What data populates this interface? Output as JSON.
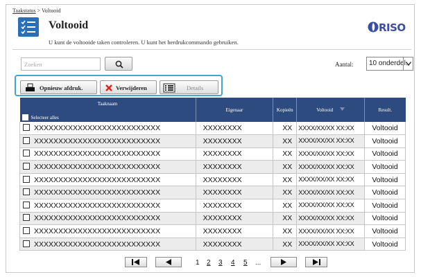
{
  "breadcrumb": {
    "parent": "Taakstatus",
    "separator": " > ",
    "current": "Voltooid"
  },
  "header": {
    "title": "Voltooid",
    "subtitle": "U kunt de voltooide taken controleren. U kunt het herdrukcommando gebruiken.",
    "icon": "completed-list-icon",
    "logo": "RISO"
  },
  "search": {
    "placeholder": "Zoeken",
    "value": "",
    "button_icon": "magnifier-icon"
  },
  "page_size": {
    "label": "Aantal:",
    "selected": "10 onderdel."
  },
  "toolbar": {
    "reprint_label": "Opnieuw afdruk.",
    "delete_label": "Verwijderen",
    "details_label": "Details",
    "accent": "#3fa6d4"
  },
  "table": {
    "header_color": "#2e4b80",
    "columns": [
      "Taaknaam",
      "Eigenaar",
      "Kopieën",
      "Voltooid",
      "Result."
    ],
    "select_all_label": "Selecteer alles",
    "rows": [
      {
        "name": "XXXXXXXXXXXXXXXXXXXXXXXXXX",
        "owner": "XXXXXXXX",
        "copies": "XX",
        "date": "XXXX/XX/XX XX:XX",
        "result": "Voltooid"
      },
      {
        "name": "XXXXXXXXXXXXXXXXXXXXXXXXXX",
        "owner": "XXXXXXXX",
        "copies": "XX",
        "date": "XXXX/XX/XX XX:XX",
        "result": "Voltooid"
      },
      {
        "name": "XXXXXXXXXXXXXXXXXXXXXXXXXX",
        "owner": "XXXXXXXX",
        "copies": "XX",
        "date": "XXXX/XX/XX XX:XX",
        "result": "Voltooid"
      },
      {
        "name": "XXXXXXXXXXXXXXXXXXXXXXXXXX",
        "owner": "XXXXXXXX",
        "copies": "XX",
        "date": "XXXX/XX/XX XX:XX",
        "result": "Voltooid"
      },
      {
        "name": "XXXXXXXXXXXXXXXXXXXXXXXXXX",
        "owner": "XXXXXXXX",
        "copies": "XX",
        "date": "XXXX/XX/XX XX:XX",
        "result": "Voltooid"
      },
      {
        "name": "XXXXXXXXXXXXXXXXXXXXXXXXXX",
        "owner": "XXXXXXXX",
        "copies": "XX",
        "date": "XXXX/XX/XX XX:XX",
        "result": "Voltooid"
      },
      {
        "name": "XXXXXXXXXXXXXXXXXXXXXXXXXX",
        "owner": "XXXXXXXX",
        "copies": "XX",
        "date": "XXXX/XX/XX XX:XX",
        "result": "Voltooid"
      },
      {
        "name": "XXXXXXXXXXXXXXXXXXXXXXXXXX",
        "owner": "XXXXXXXX",
        "copies": "XX",
        "date": "XXXX/XX/XX XX:XX",
        "result": "Voltooid"
      },
      {
        "name": "XXXXXXXXXXXXXXXXXXXXXXXXXX",
        "owner": "XXXXXXXX",
        "copies": "XX",
        "date": "XXXX/XX/XX XX:XX",
        "result": "Voltooid"
      },
      {
        "name": "XXXXXXXXXXXXXXXXXXXXXXXXXX",
        "owner": "XXXXXXXX",
        "copies": "XX",
        "date": "XXXX/XX/XX XX:XX",
        "result": "Voltooid"
      }
    ]
  },
  "pagination": {
    "pages": [
      "1",
      "2",
      "3",
      "4",
      "5"
    ],
    "current": "1",
    "ellipsis": "..."
  }
}
